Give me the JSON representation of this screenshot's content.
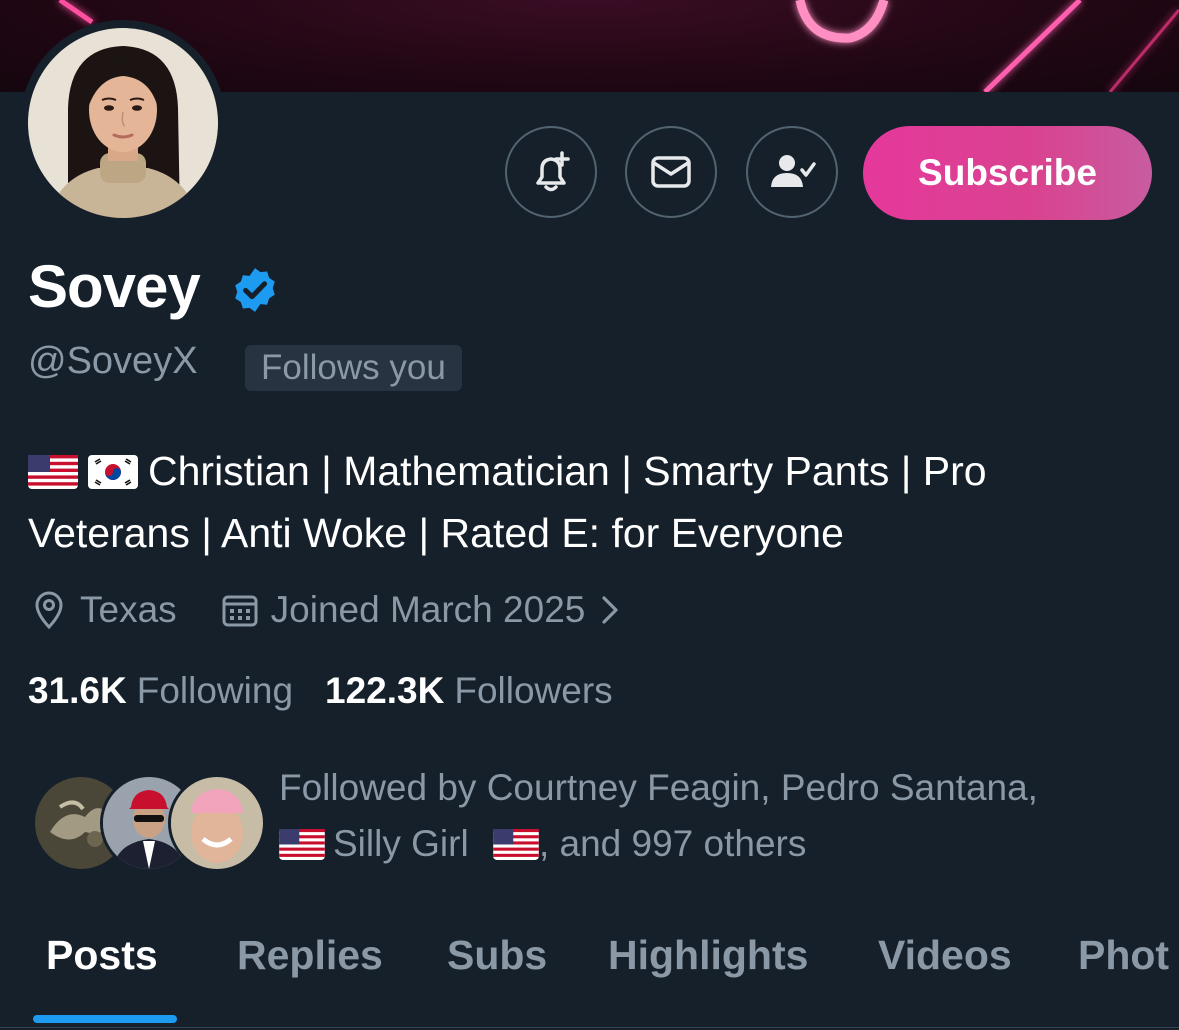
{
  "profile": {
    "display_name": "Sovey",
    "handle": "@SoveyX",
    "follows_you": "Follows you",
    "verified_color": "#1d9bf0",
    "bio_line_1": "Christian | Mathematician | Smarty Pants | Pro",
    "bio_line_2": "Veterans | Anti Woke | Rated E: for Everyone",
    "bio_flags": [
      "flag-us-icon",
      "flag-kr-icon"
    ],
    "location": "Texas",
    "joined": "Joined March 2025",
    "following_count": "31.6K",
    "following_label": "Following",
    "followers_count": "122.3K",
    "followers_label": "Followers"
  },
  "actions": {
    "notify_icon": "bell-plus-icon",
    "message_icon": "envelope-icon",
    "following_icon": "person-check-icon",
    "subscribe_label": "Subscribe",
    "subscribe_colors": [
      "#e5389c",
      "#c85ca0"
    ]
  },
  "followed_by": {
    "prefix": "Followed by Courtney Feagin, Pedro Santana,",
    "name_3": "Silly Girl",
    "suffix": ", and 997 others"
  },
  "tabs": [
    {
      "label": "Posts",
      "active": true
    },
    {
      "label": "Replies",
      "active": false
    },
    {
      "label": "Subs",
      "active": false
    },
    {
      "label": "Highlights",
      "active": false
    },
    {
      "label": "Videos",
      "active": false
    },
    {
      "label": "Phot",
      "active": false
    }
  ],
  "colors": {
    "background": "#15202b",
    "secondary_text": "#8b98a5",
    "accent": "#1d9bf0"
  }
}
